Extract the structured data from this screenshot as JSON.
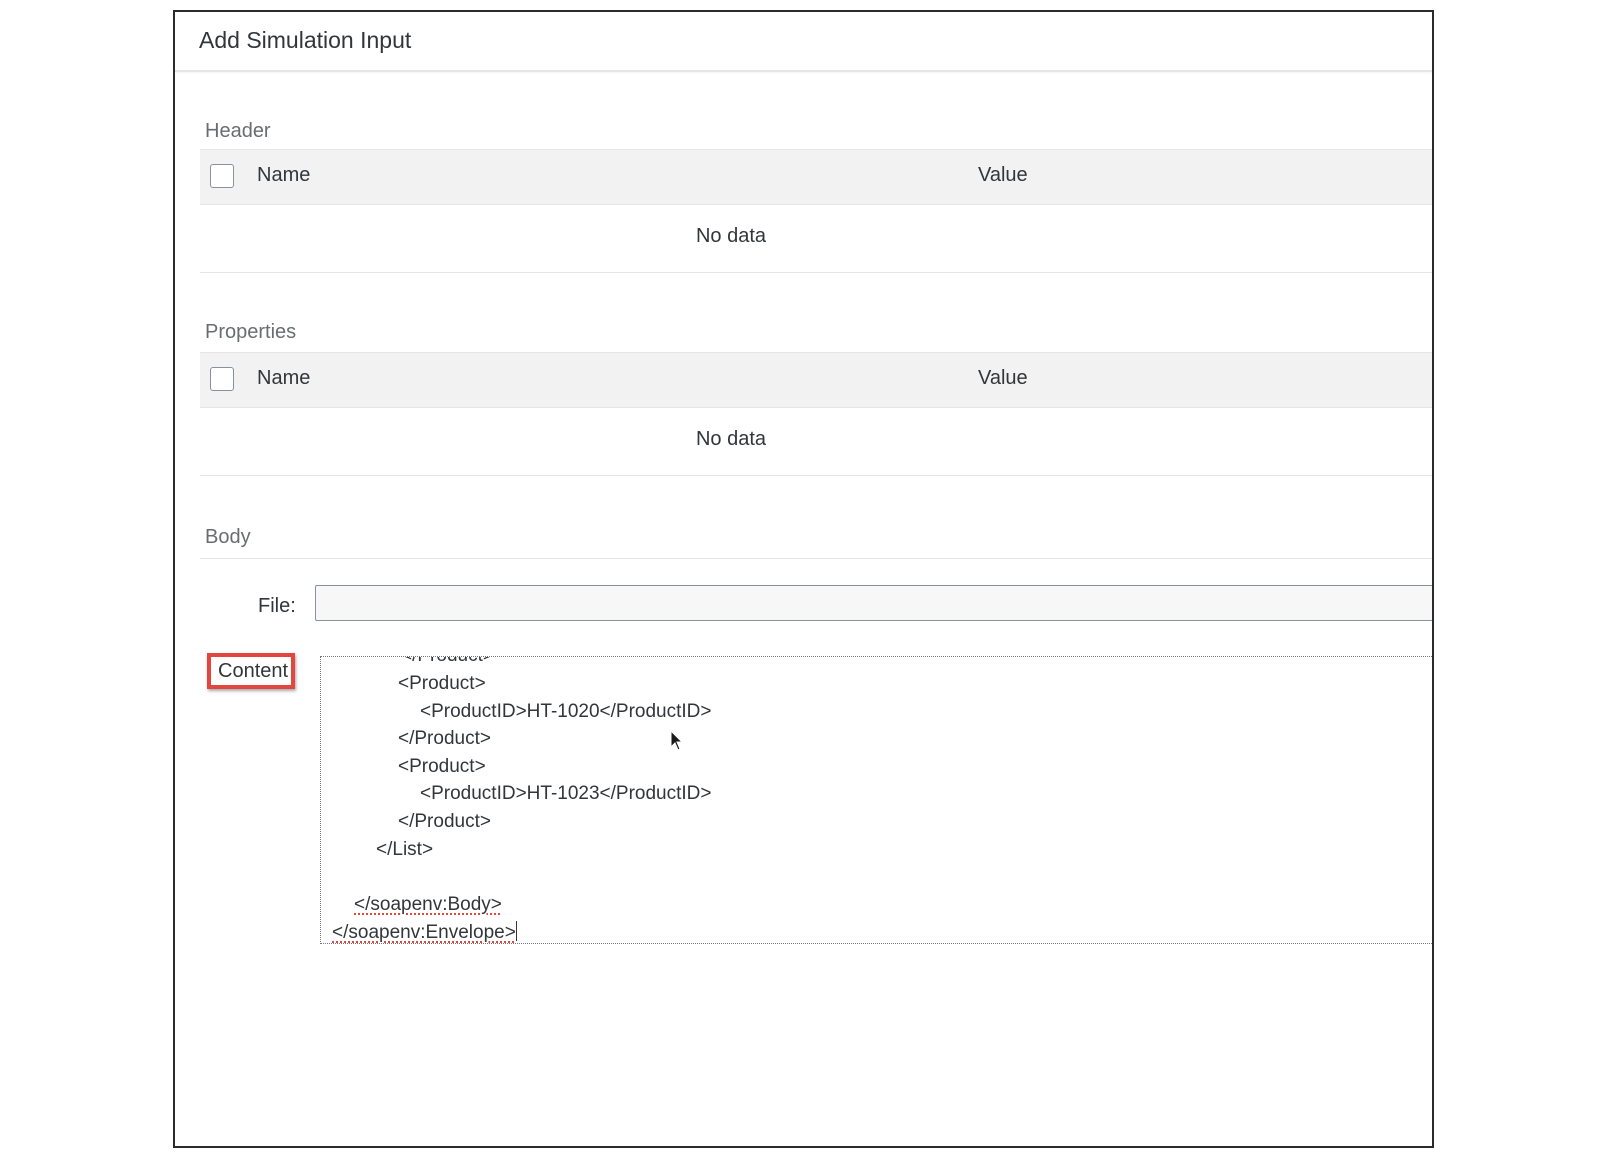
{
  "dialog": {
    "title": "Add Simulation Input"
  },
  "header_section": {
    "title": "Header",
    "columns": {
      "name": "Name",
      "value": "Value"
    },
    "empty_text": "No data"
  },
  "properties_section": {
    "title": "Properties",
    "columns": {
      "name": "Name",
      "value": "Value"
    },
    "empty_text": "No data"
  },
  "body_section": {
    "title": "Body",
    "file_label": "File:",
    "file_value": "",
    "content_label": "Content",
    "content_lines": [
      "</Product>",
      "<Product>",
      "<ProductID>HT-1020</ProductID>",
      "</Product>",
      "<Product>",
      "<ProductID>HT-1023</ProductID>",
      "</Product>",
      "</List>",
      "</soapenv:Body>",
      "</soapenv:Envelope>"
    ]
  },
  "colors": {
    "highlight_border": "#e2463f",
    "table_header_bg": "#f2f2f2",
    "text": "#32363a",
    "section_title": "#6a6d70"
  },
  "icons": {
    "mouse_cursor": "mouse-pointer-icon"
  }
}
